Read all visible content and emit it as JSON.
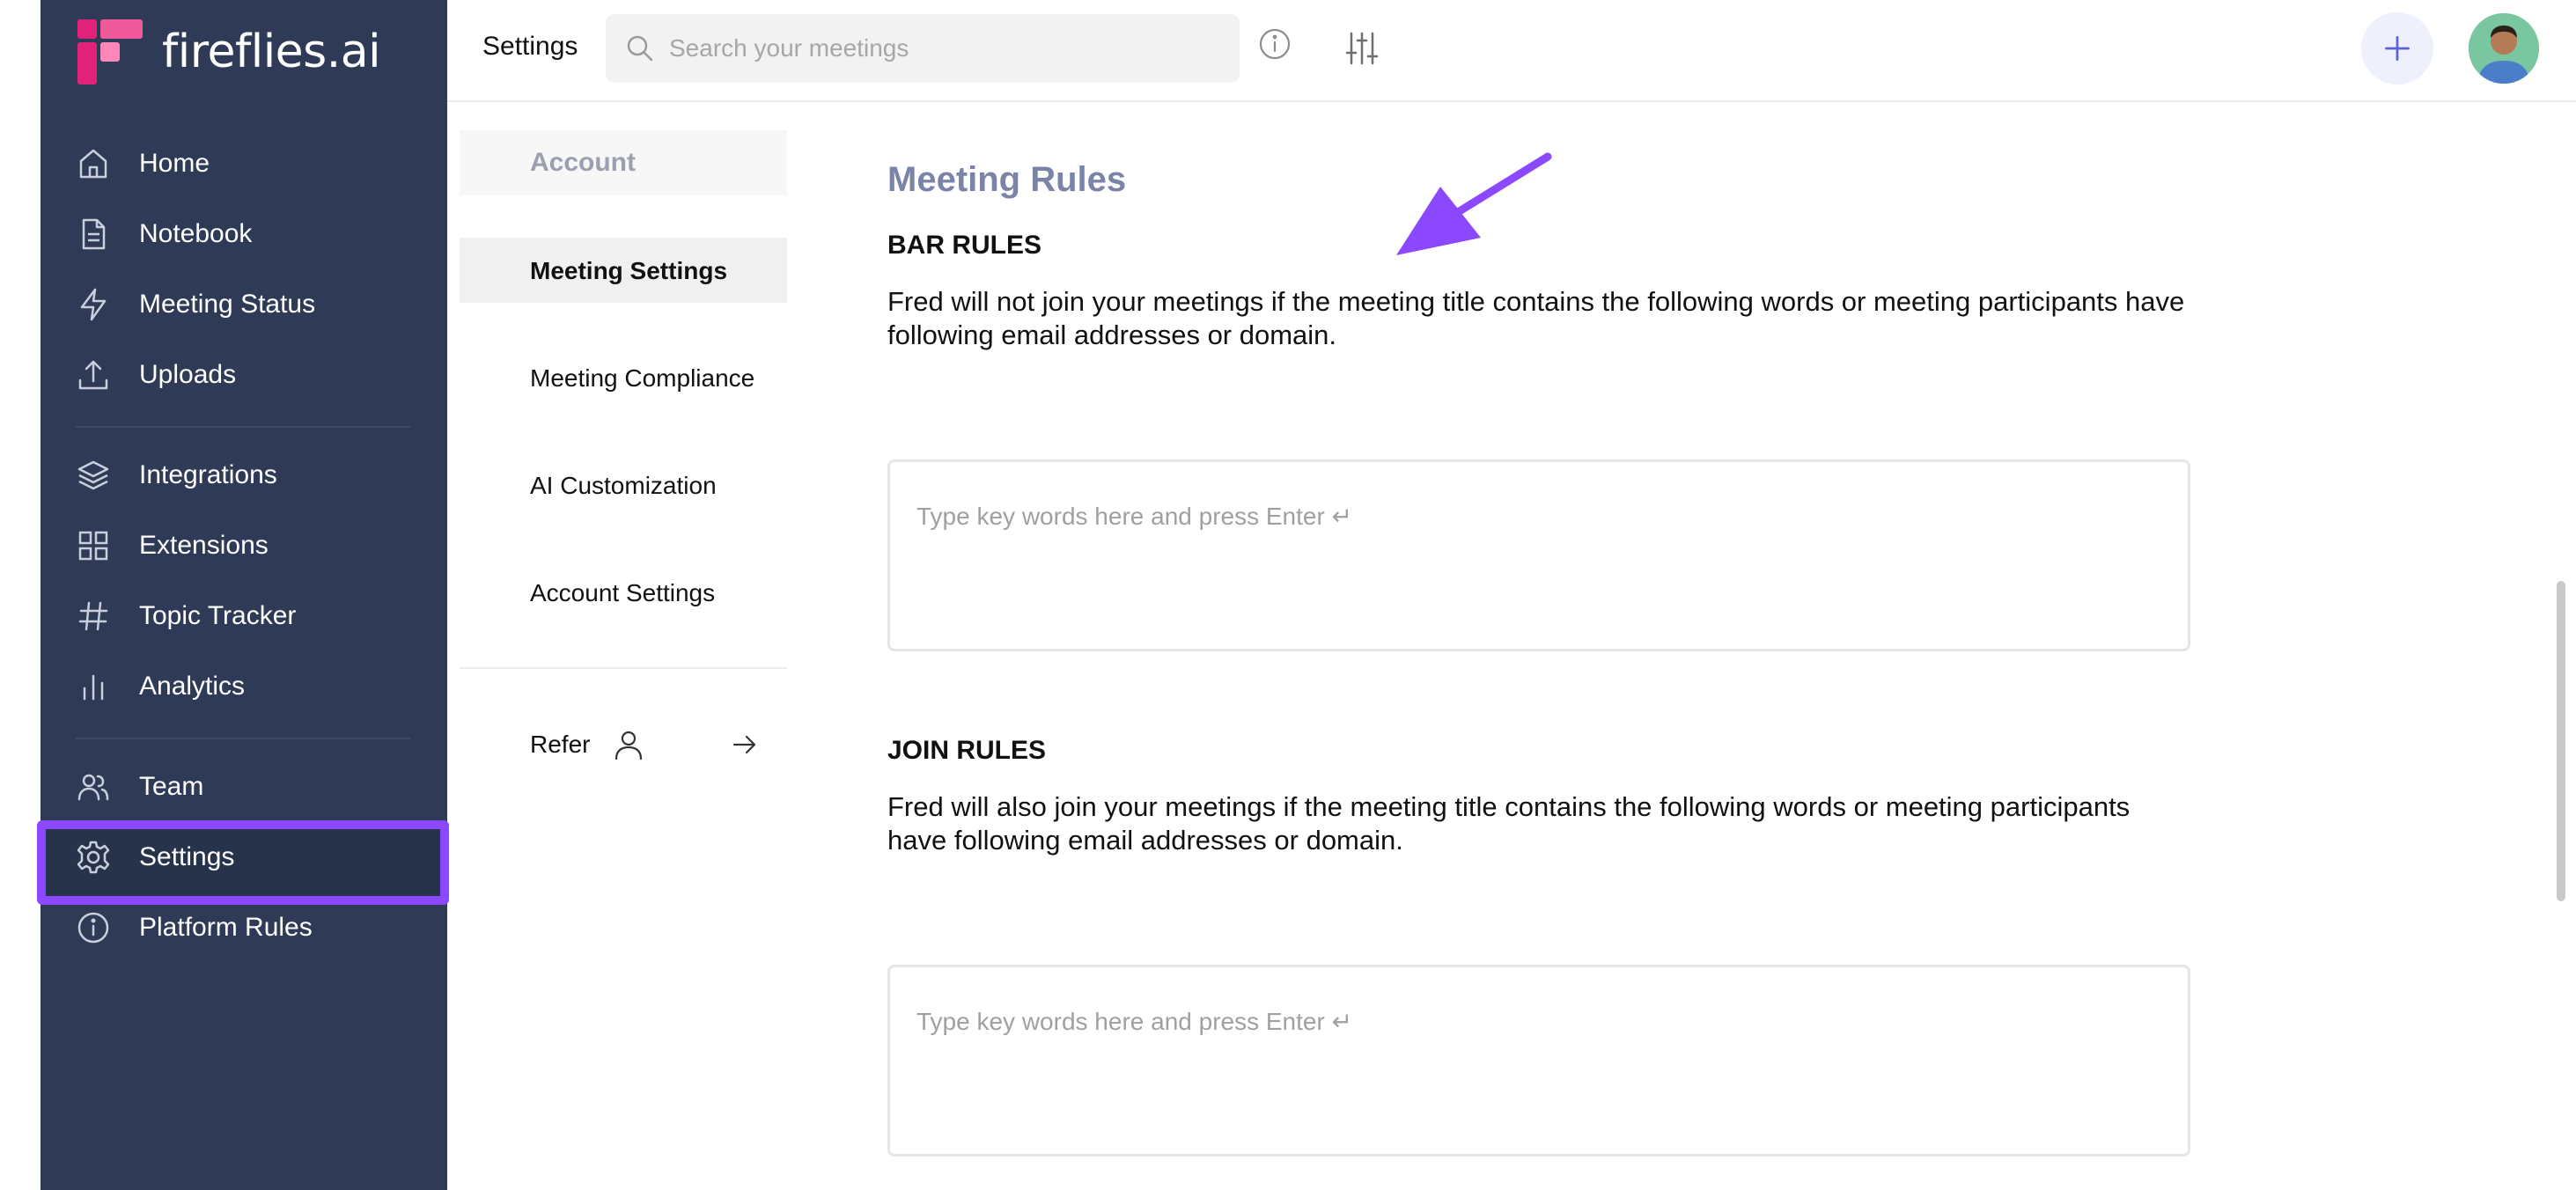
{
  "app": {
    "name": "fireflies.ai",
    "logo_colors": [
      "#e2217a",
      "#f05a9a",
      "#ff86b8"
    ]
  },
  "sidebar": {
    "background": "#2e3a56",
    "active_highlight": "#8b48ff",
    "items": [
      {
        "label": "Home",
        "icon": "home-icon"
      },
      {
        "label": "Notebook",
        "icon": "document-icon"
      },
      {
        "label": "Meeting Status",
        "icon": "lightning-icon"
      },
      {
        "label": "Uploads",
        "icon": "upload-icon"
      },
      {
        "label": "Integrations",
        "icon": "layers-icon"
      },
      {
        "label": "Extensions",
        "icon": "grid-icon"
      },
      {
        "label": "Topic Tracker",
        "icon": "hash-icon"
      },
      {
        "label": "Analytics",
        "icon": "bar-chart-icon"
      },
      {
        "label": "Team",
        "icon": "users-icon"
      },
      {
        "label": "Settings",
        "icon": "gear-icon",
        "active": true
      },
      {
        "label": "Platform Rules",
        "icon": "info-icon"
      }
    ]
  },
  "topbar": {
    "title": "Settings",
    "search_placeholder": "Search your meetings",
    "filter_icon": "sliders-icon",
    "info_icon": "info-icon",
    "add_icon": "plus-icon"
  },
  "settings_nav": {
    "header": "Account",
    "items": [
      {
        "label": "Meeting Settings",
        "active": true
      },
      {
        "label": "Meeting Compliance"
      },
      {
        "label": "AI Customization"
      },
      {
        "label": "Account Settings"
      }
    ],
    "refer": {
      "label": "Refer"
    }
  },
  "main": {
    "title": "Meeting Rules",
    "bar_rules": {
      "heading": "BAR RULES",
      "description": "Fred will not join your meetings if the meeting title contains the following words or meeting participants have following email addresses or domain.",
      "placeholder": "Type key words here and press Enter ↵"
    },
    "join_rules": {
      "heading": "JOIN RULES",
      "description": "Fred will also join your meetings if the meeting title contains the following words or meeting participants have following email addresses or domain.",
      "placeholder": "Type key words here and press Enter ↵"
    },
    "annotation_arrow_color": "#8b48ff"
  }
}
